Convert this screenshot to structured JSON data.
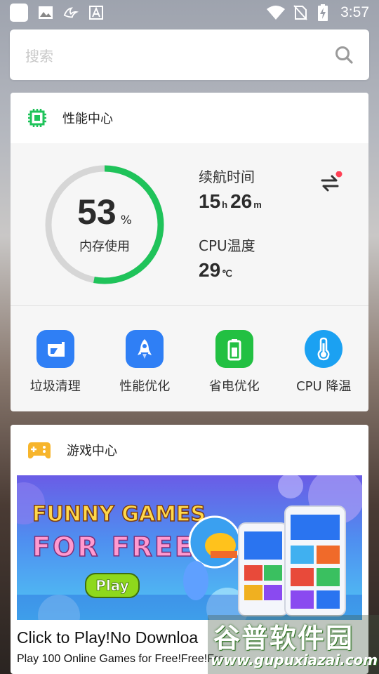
{
  "status_bar": {
    "time": "3:57",
    "icons": [
      "notification-square-icon",
      "image-icon",
      "bird-icon",
      "font-icon",
      "wifi-icon",
      "no-sim-icon",
      "battery-charging-icon"
    ]
  },
  "search": {
    "placeholder": "搜索"
  },
  "performance": {
    "title": "性能中心",
    "memory": {
      "value": "53",
      "unit": "%",
      "label": "内存使用",
      "percent": 53
    },
    "battery_life": {
      "label": "续航时间",
      "hours": "15",
      "h_unit": "h",
      "minutes": "26",
      "m_unit": "m"
    },
    "cpu_temp": {
      "label": "CPU温度",
      "value": "29",
      "unit": "℃"
    },
    "tools": [
      {
        "label": "垃圾清理",
        "icon": "broom-icon",
        "color": "#2f7ff5"
      },
      {
        "label": "性能优化",
        "icon": "rocket-icon",
        "color": "#2f7ff5"
      },
      {
        "label": "省电优化",
        "icon": "battery-icon",
        "color": "#22c042"
      },
      {
        "label": "CPU 降温",
        "icon": "thermometer-icon",
        "color": "#1ba1f2"
      }
    ],
    "accent_green": "#1fc35a"
  },
  "games": {
    "title": "游戏中心",
    "banner": {
      "headline_1": "FUNNY GAMES",
      "headline_2": "FOR FREE",
      "play": "Play"
    },
    "item_title": "Click to Play!No Downloa",
    "item_subtitle": "Play 100 Online Games for Free!Free!Fre"
  },
  "watermark": {
    "title": "谷普软件园",
    "url": "www.gupuxiazai.com"
  }
}
